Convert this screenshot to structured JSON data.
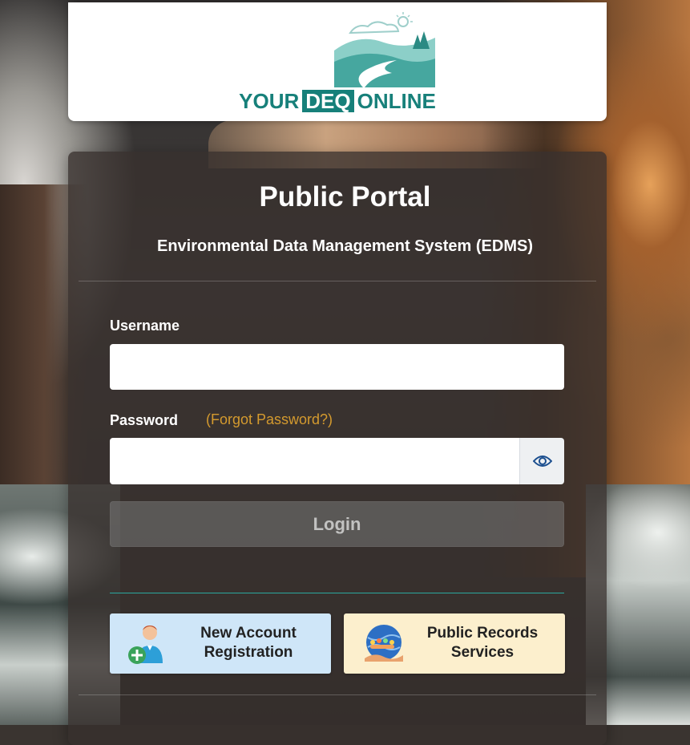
{
  "logo": {
    "text_prefix": "YOUR",
    "text_boxed": "DEQ",
    "text_suffix": "ONLINE",
    "brand_color": "#17807a"
  },
  "portal": {
    "title": "Public Portal",
    "subtitle": "Environmental Data Management System (EDMS)"
  },
  "form": {
    "username_label": "Username",
    "username_value": "",
    "password_label": "Password",
    "forgot_link": "(Forgot Password?)",
    "password_value": "",
    "show_password_icon": "eye-icon",
    "login_label": "Login"
  },
  "tiles": {
    "new_account": {
      "label": "New Account\nRegistration",
      "icon": "add-user-icon",
      "color": "#cfe6f8"
    },
    "public_records": {
      "label": "Public Records\nServices",
      "icon": "records-globe-icon",
      "color": "#fcefcd"
    }
  },
  "colors": {
    "accent_link": "#d49a2e",
    "divider_teal": "#2aa8a0"
  }
}
